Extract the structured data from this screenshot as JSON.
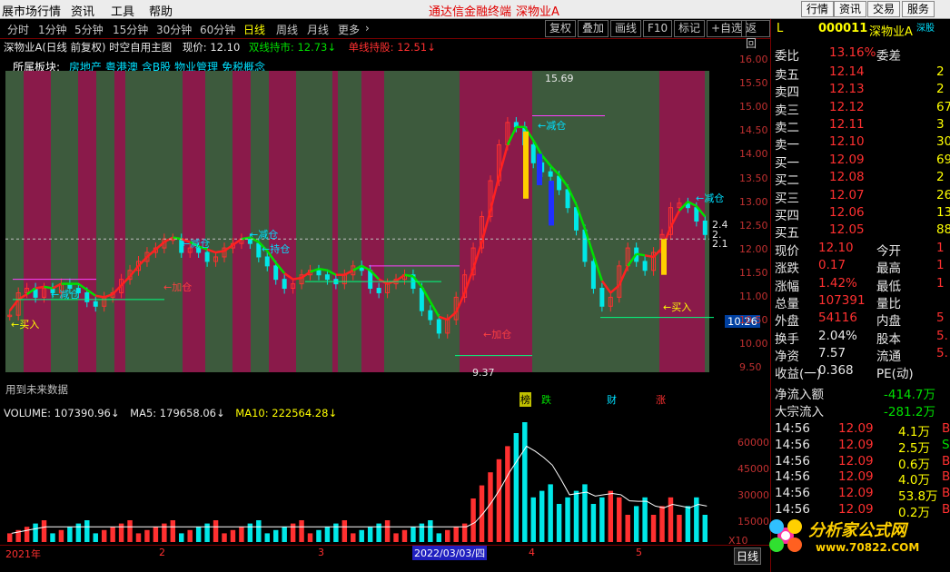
{
  "menu": {
    "items": [
      "展市场行情",
      "资讯",
      "工具",
      "帮助"
    ],
    "promo1": "通达信金融终端",
    "promo2": "深物业A",
    "buttons": [
      "行情",
      "资讯",
      "交易",
      "服务"
    ]
  },
  "toolbar": {
    "periods": [
      "分时",
      "1分钟",
      "5分钟",
      "15分钟",
      "30分钟",
      "60分钟",
      "日线",
      "周线",
      "月线",
      "更多"
    ],
    "active": "日线",
    "actions": [
      "复权",
      "叠加",
      "画线",
      "F10",
      "标记",
      "+自选",
      "返回"
    ]
  },
  "info": {
    "title": "深物业A(日线 前复权) 时空自用主图",
    "price_label": "现价: 12.10",
    "dual": "双线持市: 12.73",
    "single": "单线持股: 12.51"
  },
  "sector": {
    "label": "所属板块:",
    "tags": [
      "房地产",
      "粤港澳",
      "含B股",
      "物业管理",
      "免税概念"
    ]
  },
  "annotations": {
    "high": "15.69",
    "low": "9.37",
    "buy": "←买入",
    "add": "←加仓",
    "reduce": "←减仓",
    "hold": "←持仓",
    "future": "用到未来数据",
    "price_tag": "10.26"
  },
  "axis_right": [
    "16.00",
    "15.50",
    "15.00",
    "14.50",
    "14.00",
    "13.50",
    "13.00",
    "12.50",
    "12.00",
    "11.50",
    "11.00",
    "10.50",
    "10.00",
    "9.50"
  ],
  "side_vals_right": [
    "2.4",
    "2.",
    "2.1"
  ],
  "volume": {
    "label": "VOLUME: 107390.96",
    "ma5": "MA5: 179658.06",
    "ma10": "MA10: 222564.28",
    "axis": [
      "60000",
      "45000",
      "30000",
      "15000",
      "X10"
    ]
  },
  "events": [
    "榜",
    "跌",
    "财",
    "涨"
  ],
  "dates": {
    "y2021": "2021年",
    "selected": "2022/03/03/四",
    "m2": "2",
    "m3": "3",
    "m4": "4",
    "m5": "5"
  },
  "stock": {
    "code": "000011",
    "name": "深物业A",
    "badge": "深股",
    "label": "L",
    "webi_label": "委比",
    "webi": "13.16%",
    "weicha": "委差"
  },
  "asks": [
    {
      "n": "卖五",
      "p": "12.14",
      "v": "2"
    },
    {
      "n": "卖四",
      "p": "12.13",
      "v": "2"
    },
    {
      "n": "卖三",
      "p": "12.12",
      "v": "67"
    },
    {
      "n": "卖二",
      "p": "12.11",
      "v": "3"
    },
    {
      "n": "卖一",
      "p": "12.10",
      "v": "30"
    }
  ],
  "bids": [
    {
      "n": "买一",
      "p": "12.09",
      "v": "69"
    },
    {
      "n": "买二",
      "p": "12.08",
      "v": "2"
    },
    {
      "n": "买三",
      "p": "12.07",
      "v": "26"
    },
    {
      "n": "买四",
      "p": "12.06",
      "v": "13"
    },
    {
      "n": "买五",
      "p": "12.05",
      "v": "88"
    }
  ],
  "stats": [
    {
      "a": "现价",
      "b": "12.10",
      "c": "今开",
      "d": "1"
    },
    {
      "a": "涨跌",
      "b": "0.17",
      "c": "最高",
      "d": "1"
    },
    {
      "a": "涨幅",
      "b": "1.42%",
      "c": "最低",
      "d": "1"
    },
    {
      "a": "总量",
      "b": "107391",
      "c": "量比",
      "d": ""
    },
    {
      "a": "外盘",
      "b": "54116",
      "c": "内盘",
      "d": "5"
    },
    {
      "a": "换手",
      "b": "2.04%",
      "c": "股本",
      "d": "5."
    },
    {
      "a": "净资",
      "b": "7.57",
      "c": "流通",
      "d": "5."
    },
    {
      "a": "收益(一)",
      "b": "0.368",
      "c": "PE(动)",
      "d": ""
    }
  ],
  "flows": [
    {
      "a": "净流入额",
      "b": "-414.7万"
    },
    {
      "a": "大宗流入",
      "b": "-281.2万"
    }
  ],
  "ticks": [
    {
      "t": "14:56",
      "p": "12.09",
      "v": "4.1万",
      "s": "B"
    },
    {
      "t": "14:56",
      "p": "12.09",
      "v": "2.5万",
      "s": "S"
    },
    {
      "t": "14:56",
      "p": "12.09",
      "v": "0.6万",
      "s": "B"
    },
    {
      "t": "14:56",
      "p": "12.09",
      "v": "4.0万",
      "s": "B"
    },
    {
      "t": "14:56",
      "p": "12.09",
      "v": "53.8万",
      "s": "B"
    },
    {
      "t": "14:56",
      "p": "12.09",
      "v": "0.2万",
      "s": "B"
    }
  ],
  "bottom_tab": "日线",
  "brand": {
    "name": "分析家公式网",
    "url": "www.70822.COM"
  },
  "chart_data": {
    "type": "candlestick",
    "ylim": [
      9.37,
      15.69
    ],
    "close": [
      10.4,
      10.9,
      11.0,
      10.8,
      11.0,
      10.9,
      11.1,
      11.0,
      10.9,
      10.7,
      10.6,
      10.8,
      10.9,
      11.2,
      11.4,
      11.6,
      11.8,
      11.9,
      12.1,
      12.1,
      11.8,
      11.9,
      11.8,
      11.6,
      11.7,
      11.9,
      12.0,
      12.1,
      12.0,
      11.7,
      11.5,
      11.2,
      11.0,
      11.1,
      11.3,
      11.4,
      11.3,
      11.2,
      11.1,
      11.3,
      11.5,
      11.4,
      11.0,
      10.9,
      11.1,
      11.2,
      11.3,
      11.0,
      10.5,
      10.3,
      10.0,
      10.3,
      10.8,
      11.3,
      11.9,
      12.6,
      13.4,
      14.2,
      14.7,
      14.6,
      14.2,
      13.8,
      13.6,
      13.5,
      13.2,
      12.8,
      12.3,
      11.6,
      11.0,
      10.6,
      10.8,
      11.5,
      11.9,
      11.6,
      11.4,
      11.8,
      12.2,
      12.8,
      12.9,
      12.8,
      12.5,
      12.2
    ]
  }
}
